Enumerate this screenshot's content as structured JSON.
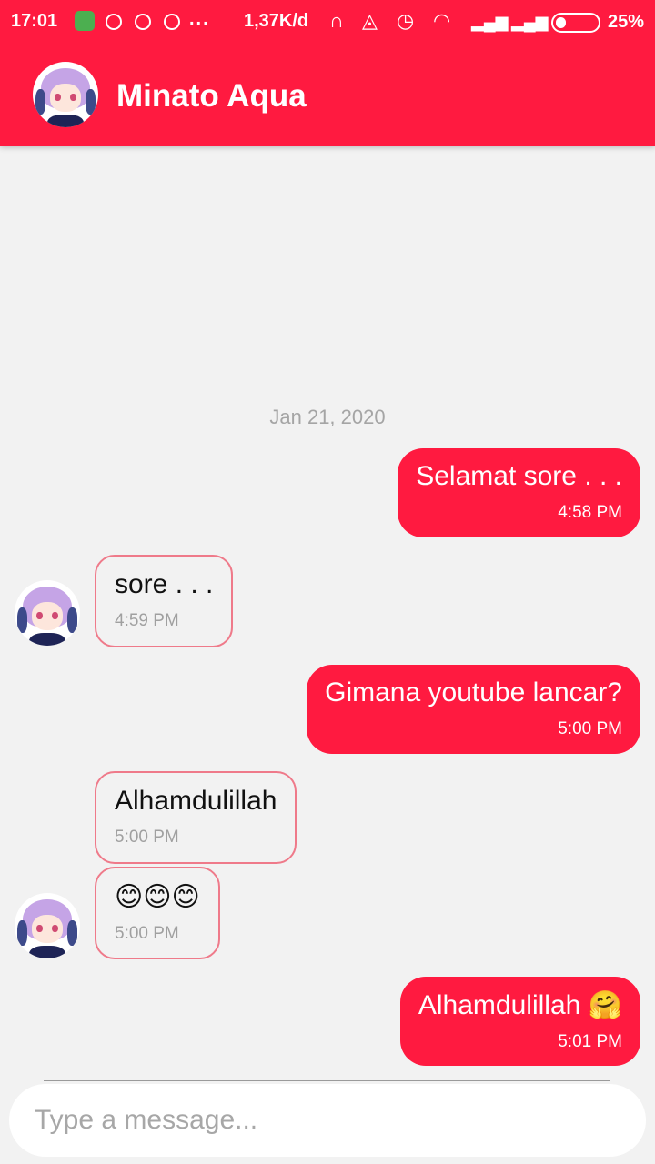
{
  "status_bar": {
    "time": "17:01",
    "more": "...",
    "net_speed": "1,37K/d",
    "battery_percent": "25%",
    "battery_level": 0.25,
    "icons": [
      "notification-app-icon",
      "whatsapp-icon",
      "whatsapp-icon",
      "whatsapp-icon",
      "headphones-icon",
      "bell-off-icon",
      "alarm-icon",
      "wifi-icon",
      "signal-icon",
      "signal-icon",
      "battery-icon"
    ]
  },
  "header": {
    "title": "Minato Aqua",
    "avatar": "contact-avatar"
  },
  "chat": {
    "date_label": "Jan 21, 2020",
    "messages": [
      {
        "direction": "sent",
        "text": "Selamat sore . . .",
        "time": "4:58 PM"
      },
      {
        "direction": "received",
        "text": "sore . . .",
        "time": "4:59 PM"
      },
      {
        "direction": "sent",
        "text": "Gimana youtube lancar?",
        "time": "5:00 PM"
      },
      {
        "direction": "received",
        "text": "Alhamdulillah",
        "time": "5:00 PM"
      },
      {
        "direction": "received",
        "text": "😊😊😊",
        "time": "5:00 PM"
      },
      {
        "direction": "sent",
        "text": "Alhamdulillah 🤗",
        "time": "5:01 PM"
      }
    ]
  },
  "composer": {
    "placeholder": "Type a message..."
  },
  "colors": {
    "accent": "#ff1a40",
    "received_border": "#ef7a8a",
    "background": "#f2f2f2"
  }
}
